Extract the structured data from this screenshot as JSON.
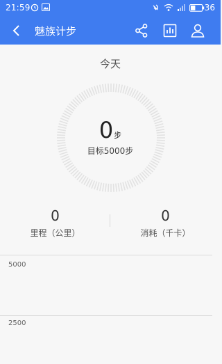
{
  "status_bar": {
    "time": "21:59",
    "battery": "36"
  },
  "app_bar": {
    "title": "魅族计步"
  },
  "summary": {
    "day_label": "今天",
    "steps": "0",
    "steps_unit": "步",
    "goal": "目标5000步",
    "goal_progress": 0
  },
  "stats": [
    {
      "value": "0",
      "label": "里程（公里）"
    },
    {
      "value": "0",
      "label": "消耗（千卡）"
    }
  ],
  "chart_data": {
    "type": "bar",
    "categories": [],
    "values": [],
    "ytick_labels": [
      "5000",
      "2500"
    ]
  }
}
